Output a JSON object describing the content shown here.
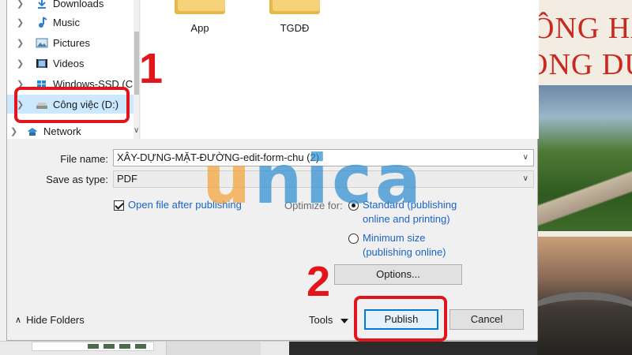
{
  "dialog": {
    "nav_items": [
      {
        "label": "Downloads",
        "icon": "download-icon"
      },
      {
        "label": "Music",
        "icon": "music-icon"
      },
      {
        "label": "Pictures",
        "icon": "pictures-icon"
      },
      {
        "label": "Videos",
        "icon": "videos-icon"
      },
      {
        "label": "Windows-SSD (C",
        "icon": "windows-drive-icon"
      },
      {
        "label": "Công việc (D:)",
        "icon": "drive-icon",
        "selected": true
      },
      {
        "label": "Network",
        "icon": "network-icon"
      }
    ],
    "files": [
      {
        "name": "App"
      },
      {
        "name": "TGDĐ"
      }
    ],
    "file_name_label": "File name:",
    "file_name_value": "XÂY-DỰNG-MẶT-ĐƯỜNG-edit-form-chu (2)",
    "save_as_type_label": "Save as type:",
    "save_as_type_value": "PDF",
    "open_after_label": "Open file after publishing",
    "optimize_label": "Optimize for:",
    "optimize_standard": "Standard (publishing online and printing)",
    "optimize_standard_line1": "Standard (publishing",
    "optimize_standard_line2": "online and printing)",
    "optimize_min_line1": "Minimum size",
    "optimize_min_line2": "(publishing online)",
    "options_button": "Options...",
    "hide_folders": "Hide Folders",
    "tools": "Tools",
    "publish_button": "Publish",
    "cancel_button": "Cancel"
  },
  "background": {
    "headline_1": "ÔNG HA",
    "headline_2": "ONG DU"
  },
  "annotations": {
    "step_1": "1",
    "step_2": "2",
    "color": "#e0161c"
  },
  "watermark": {
    "first": "u",
    "rest": "nica"
  }
}
